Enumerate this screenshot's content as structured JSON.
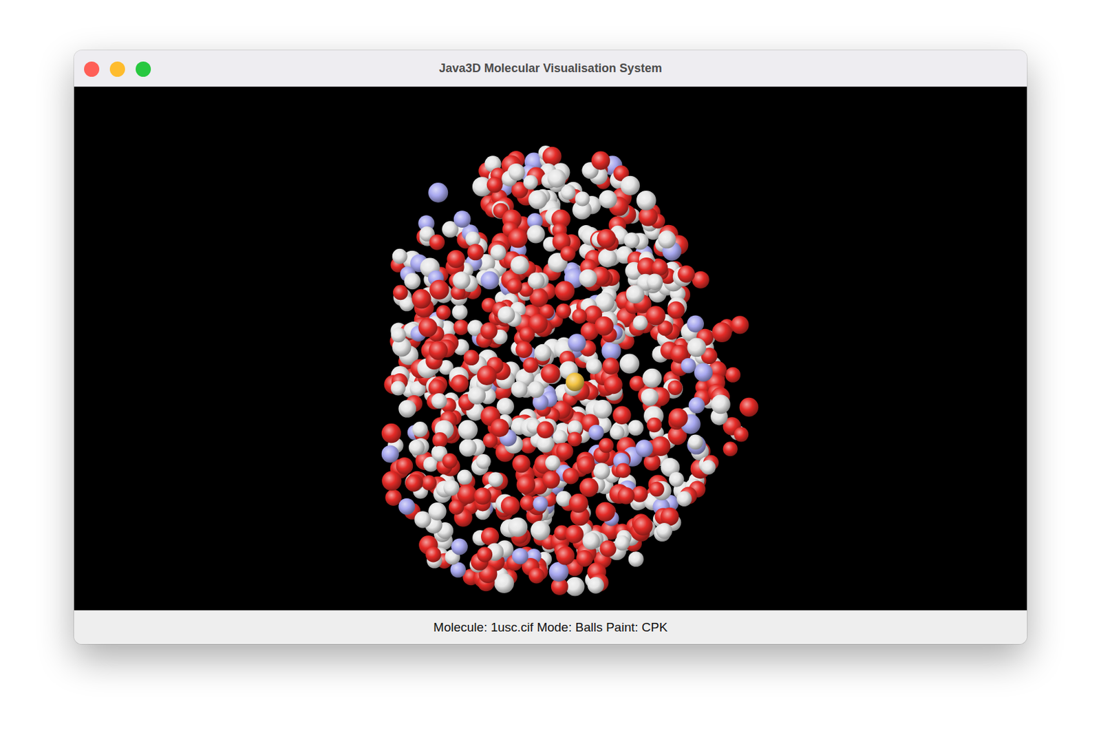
{
  "window": {
    "title": "Java3D Molecular Visualisation System"
  },
  "viewport": {
    "atom_groups": [
      {
        "color": "#e42b27",
        "count": 430
      },
      {
        "color": "#e6e6e6",
        "count": 360
      },
      {
        "color": "#a8a8ef",
        "count": 70
      },
      {
        "color": "#f2c341",
        "count": 1
      }
    ]
  },
  "status_bar": "Molecule: 1usc.cif Mode: Balls Paint: CPK"
}
